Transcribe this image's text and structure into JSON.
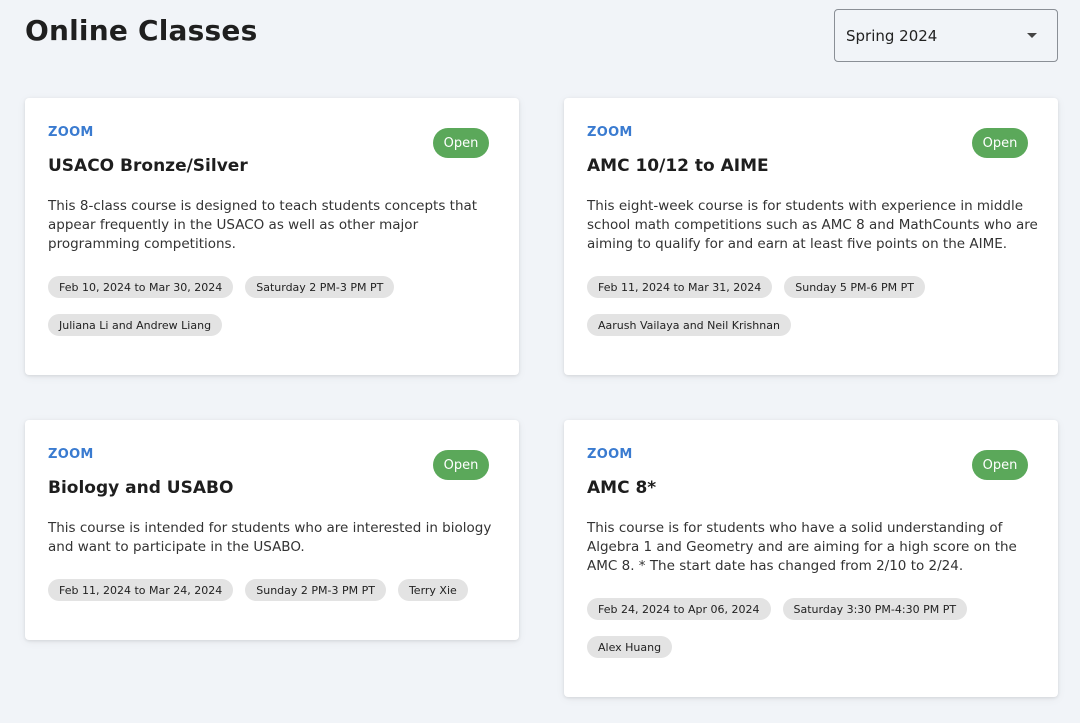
{
  "header": {
    "title": "Online Classes",
    "term_select": {
      "value": "Spring 2024"
    }
  },
  "courses": [
    {
      "platform": "ZOOM",
      "status": "Open",
      "title": "USACO Bronze/Silver",
      "description": "This 8-class course is designed to teach students concepts that appear frequently in the USACO as well as other major programming competitions.",
      "dates": "Feb 10, 2024 to Mar 30, 2024",
      "time": "Saturday 2 PM-3 PM PT",
      "instructors": "Juliana Li and Andrew Liang"
    },
    {
      "platform": "ZOOM",
      "status": "Open",
      "title": "AMC 10/12 to AIME",
      "description": "This eight-week course is for students with experience in middle school math competitions such as AMC 8 and MathCounts who are aiming to qualify for and earn at least five points on the AIME.",
      "dates": "Feb 11, 2024 to Mar 31, 2024",
      "time": "Sunday 5 PM-6 PM PT",
      "instructors": "Aarush Vailaya and Neil Krishnan"
    },
    {
      "platform": "ZOOM",
      "status": "Open",
      "title": "Biology and USABO",
      "description": "This course is intended for students who are interested in biology and want to participate in the USABO.",
      "dates": "Feb 11, 2024 to Mar 24, 2024",
      "time": "Sunday 2 PM-3 PM PT",
      "instructors": "Terry Xie"
    },
    {
      "platform": "ZOOM",
      "status": "Open",
      "title": "AMC 8*",
      "description": "This course is for students who have a solid understanding of Algebra 1 and Geometry and are aiming for a high score on the AMC 8. * The start date has changed from 2/10 to 2/24.",
      "dates": "Feb 24, 2024 to Apr 06, 2024",
      "time": "Saturday 3:30 PM-4:30 PM PT",
      "instructors": "Alex Huang"
    }
  ],
  "colors": {
    "accent": "#3a7bd0",
    "status_open": "#5ba85a",
    "background": "#f1f4f8",
    "tag_background": "#e3e3e3"
  },
  "icons": {
    "term_select_caret": "chevron-down-icon"
  }
}
